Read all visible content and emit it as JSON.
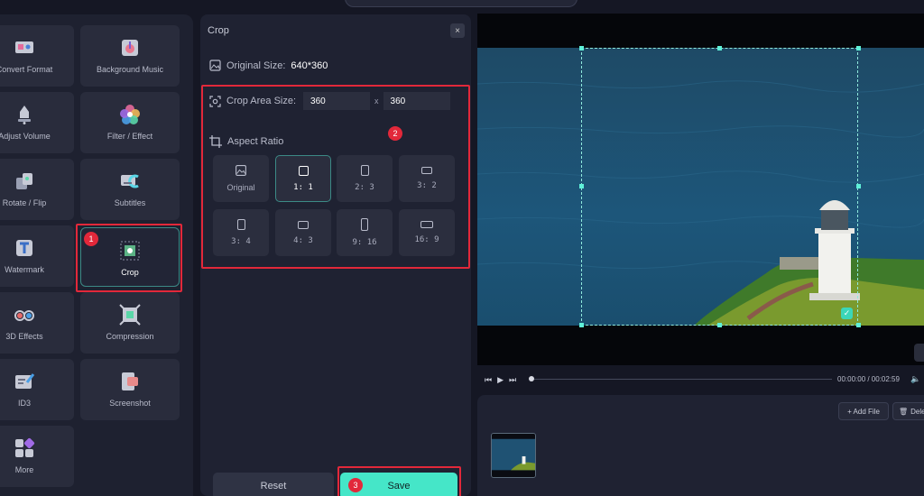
{
  "tools": [
    {
      "label": "Convert Format",
      "icon": "convert-format-icon"
    },
    {
      "label": "Background Music",
      "icon": "background-music-icon"
    },
    {
      "label": "Adjust Volume",
      "icon": "adjust-volume-icon"
    },
    {
      "label": "Filter / Effect",
      "icon": "filter-effect-icon"
    },
    {
      "label": "Rotate / Flip",
      "icon": "rotate-flip-icon"
    },
    {
      "label": "Subtitles",
      "icon": "subtitles-icon"
    },
    {
      "label": "Watermark",
      "icon": "watermark-icon"
    },
    {
      "label": "Crop",
      "icon": "crop-icon"
    },
    {
      "label": "3D Effects",
      "icon": "3d-effects-icon"
    },
    {
      "label": "Compression",
      "icon": "compression-icon"
    },
    {
      "label": "ID3",
      "icon": "id3-icon"
    },
    {
      "label": "Screenshot",
      "icon": "screenshot-icon"
    },
    {
      "label": "More",
      "icon": "more-icon"
    }
  ],
  "crop": {
    "title": "Crop",
    "close": "×",
    "original_label": "Original Size:",
    "original_value": "640*360",
    "area_label": "Crop Area Size:",
    "width": "360",
    "x": "x",
    "height": "360",
    "aspect_label": "Aspect Ratio",
    "ratios": [
      "Original",
      "1: 1",
      "2: 3",
      "3: 2",
      "3: 4",
      "4: 3",
      "9: 16",
      "16: 9"
    ],
    "reset": "Reset",
    "save": "Save"
  },
  "badges": [
    "1",
    "2",
    "3"
  ],
  "player": {
    "time": "00:00:00 / 00:02:59",
    "progress": 0
  },
  "files": {
    "add": "+ Add File",
    "delete": "Delet"
  },
  "colors": {
    "accent": "#45e6c8",
    "highlight": "#e2283a"
  }
}
